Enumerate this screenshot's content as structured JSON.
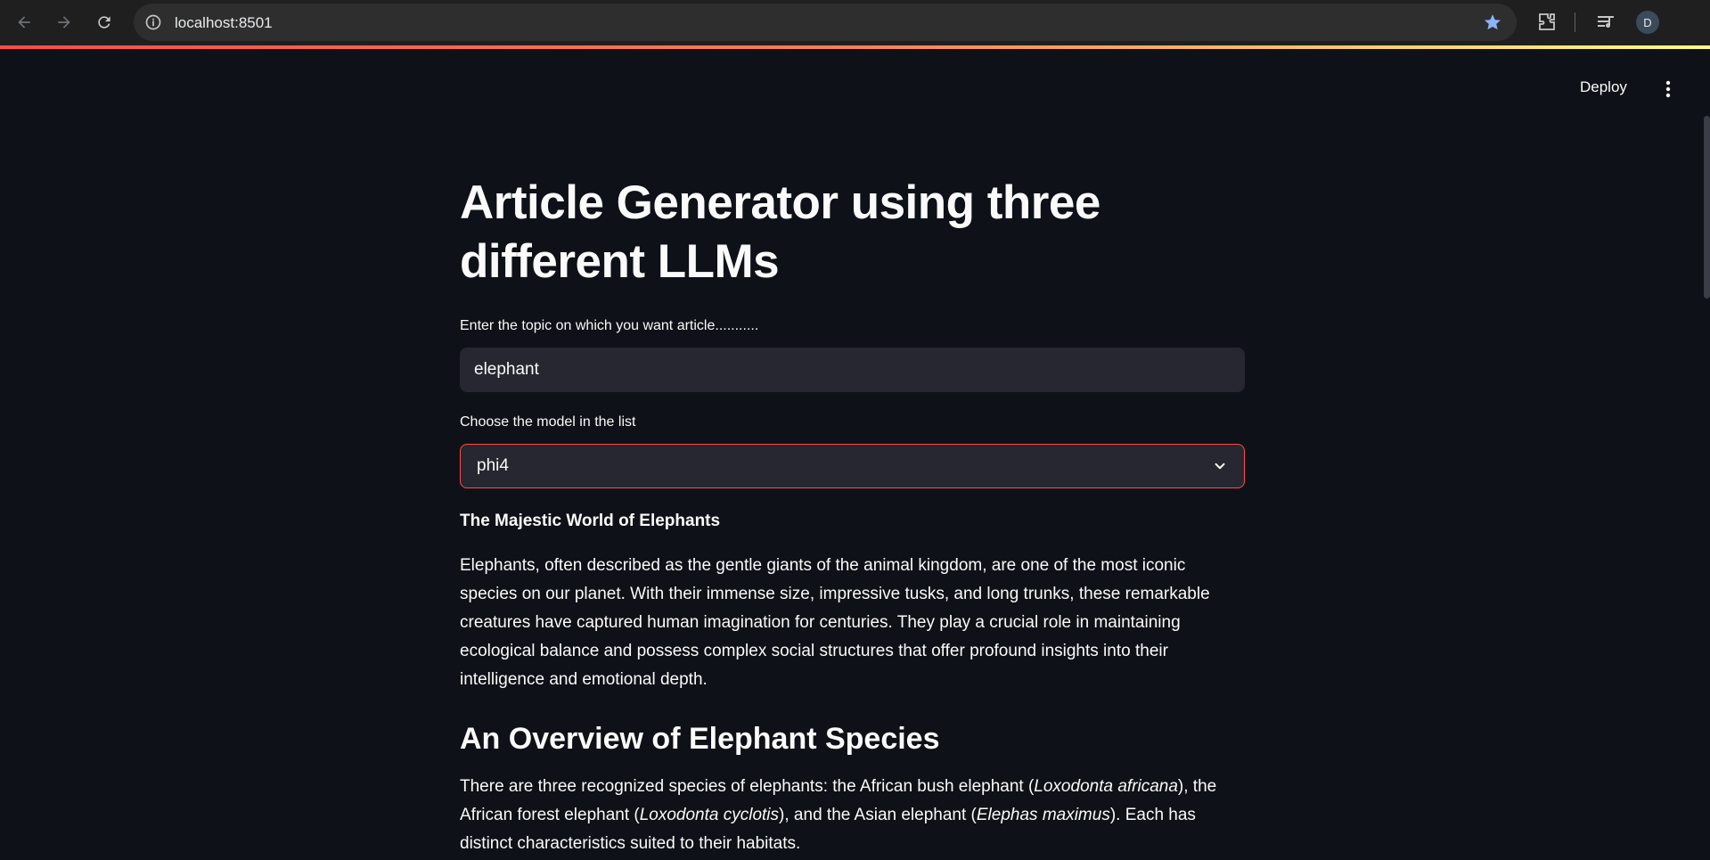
{
  "browser": {
    "url": "localhost:8501",
    "profile_initial": "D",
    "accent_gradient": [
      "#ff4b4b",
      "#ff7f50",
      "#fffd80"
    ]
  },
  "header": {
    "deploy_label": "Deploy"
  },
  "app": {
    "title": "Article Generator using three different LLMs",
    "topic_label": "Enter the topic on which you want article...........",
    "topic_value": "elephant",
    "model_label": "Choose the model in the list",
    "model_value": "phi4"
  },
  "article": {
    "title": "The Majestic World of Elephants",
    "intro": "Elephants, often described as the gentle giants of the animal kingdom, are one of the most iconic species on our planet. With their immense size, impressive tusks, and long trunks, these remarkable creatures have captured human imagination for centuries. They play a crucial role in maintaining ecological balance and possess complex social structures that offer profound insights into their intelligence and emotional depth.",
    "section_heading": "An Overview of Elephant Species",
    "species_text_1": "There are three recognized species of elephants: the African bush elephant (",
    "species_name_1": "Loxodonta africana",
    "species_text_2": "), the African forest elephant (",
    "species_name_2": "Loxodonta cyclotis",
    "species_text_3": "), and the Asian elephant (",
    "species_name_3": "Elephas maximus",
    "species_text_4": "). Each has distinct characteristics suited to their habitats."
  }
}
